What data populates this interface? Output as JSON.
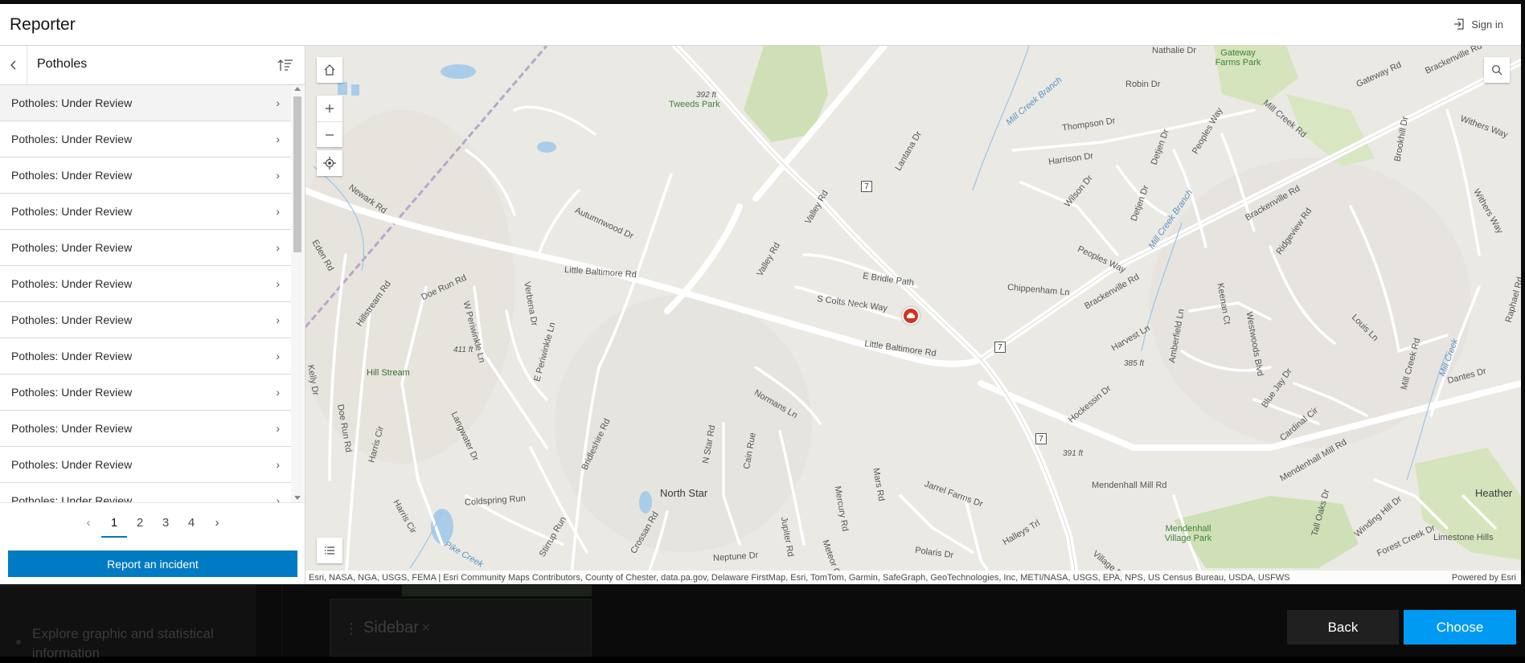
{
  "app": {
    "title": "Reporter",
    "sign_in_label": "Sign in"
  },
  "panel": {
    "title": "Potholes",
    "items": [
      {
        "label": "Potholes: Under Review"
      },
      {
        "label": "Potholes: Under Review"
      },
      {
        "label": "Potholes: Under Review"
      },
      {
        "label": "Potholes: Under Review"
      },
      {
        "label": "Potholes: Under Review"
      },
      {
        "label": "Potholes: Under Review"
      },
      {
        "label": "Potholes: Under Review"
      },
      {
        "label": "Potholes: Under Review"
      },
      {
        "label": "Potholes: Under Review"
      },
      {
        "label": "Potholes: Under Review"
      },
      {
        "label": "Potholes: Under Review"
      },
      {
        "label": "Potholes: Under Review"
      }
    ],
    "pages": [
      "1",
      "2",
      "3",
      "4"
    ],
    "current_page": "1",
    "report_button": "Report an incident"
  },
  "map": {
    "attribution": "Esri, NASA, NGA, USGS, FEMA | Esri Community Maps Contributors, County of Chester, data.pa.gov, Delaware FirstMap, Esri, TomTom, Garmin, SafeGraph, GeoTechnologies, Inc, METI/NASA, USGS, EPA, NPS, US Census Bureau, USDA, USFWS",
    "powered_by": "Powered by Esri",
    "places": {
      "north_star": "North Star",
      "heather": "Heather",
      "hill_stream": "Hill Stream",
      "limestone_hills": "Limestone Hills"
    },
    "parks": {
      "tweeds": "Tweeds Park",
      "gateway": "Gateway Farms Park",
      "mendenhall": "Mendenhall Village Park"
    },
    "water": {
      "mill_creek_branch_1": "Mill Creek Branch",
      "mill_creek_branch_2": "Mill Creek Branch",
      "mill_creek": "Mill Creek",
      "pike_creek": "Pike Creek"
    },
    "elevations": [
      "392 ft",
      "411 ft",
      "385 ft",
      "391 ft"
    ],
    "shields": [
      "7",
      "7",
      "7"
    ],
    "roads": {
      "nathalie": "Nathalie Dr",
      "robin": "Robin Dr",
      "gateway": "Gateway Rd",
      "brackenville_top": "Brackenville Rd",
      "mill_creek_rd_top": "Mill Creek Rd",
      "thompson": "Thompson Dr",
      "harrison": "Harrison Dr",
      "wilson": "Wilson Dr",
      "detjen1": "Detjen Dr",
      "detjen2": "Detjen Dr",
      "peoples_way1": "Peoples Way",
      "peoples_way2": "Peoples Way",
      "brookhill": "Brookhill Dr",
      "withers1": "Withers Way",
      "withers2": "Withers Way",
      "brackenville_mid": "Brackenville Rd",
      "brackenville_low": "Brackenville Rd",
      "ridgeview": "Ridgeview Rd",
      "raphael": "Raphael Rd",
      "lantana": "Lantana Dr",
      "valley_rd1": "Valley Rd",
      "valley_rd2": "Valley Rd",
      "newark": "Newark Rd",
      "autumnwood": "Autumnwood Dr",
      "eden": "Eden Rd",
      "little_baltimore1": "Little Baltimore Rd",
      "little_baltimore2": "Little Baltimore Rd",
      "e_bridle": "E Bridle Path",
      "s_colts": "S Colts Neck Way",
      "chippenham": "Chippenham Ln",
      "hillstream": "Hillstream Rd",
      "doe_run1": "Doe Run Rd",
      "doe_run2": "Doe Run Rd",
      "verbena": "Verbena Dr",
      "w_periwinkle": "W Periwinkle Ln",
      "e_periwinkle": "E Periwinkle Ln",
      "kelly": "Kelly Dr",
      "harvest": "Harvest Ln",
      "amberfield": "Amberfield Ln",
      "keenan": "Keenan Ct",
      "westwoods": "Westwoods Blvd",
      "louis": "Louis Ln",
      "mill_creek_rd_mid": "Mill Creek Rd",
      "dantes": "Dantes Dr",
      "normans": "Normans Ln",
      "hockessin": "Hockessin Dr",
      "blue_jay": "Blue Jay Dr",
      "cardinal": "Cardinal Cir",
      "mendenhall_mill1": "Mendenhall Mill Rd",
      "mendenhall_mill2": "Mendenhall Mill Rd",
      "harris_cir1": "Harris Cir",
      "harris_cir2": "Harris Cir",
      "langwater": "Langwater Dr",
      "bridleshire": "Bridleshire Rd",
      "n_star": "N Star Rd",
      "cain": "Cain Rue",
      "mercury": "Mercury Rd",
      "mars": "Mars Rd",
      "jarrel_farms": "Jarrel Farms Dr",
      "coldspring": "Coldspring Run",
      "tall_oaks": "Tall Oaks Dr",
      "winding_hill": "Winding Hill Dr",
      "forest_creek": "Forest Creek Dr",
      "halleys": "Halleys Trl",
      "polaris": "Polaris Dr",
      "neptune": "Neptune Dr",
      "jupiter": "Jupiter Rd",
      "meteor": "Meteor Ct",
      "crossan": "Crossan Rd",
      "stirrup": "Stirrup Run",
      "village": "Village Dr"
    }
  },
  "footer": {
    "back": "Back",
    "choose": "Choose"
  },
  "background": {
    "explore_text": "Explore graphic and statistical information",
    "sidebar_label": "Sidebar"
  },
  "colors": {
    "accent": "#007ac2",
    "choose": "#009af2",
    "marker": "#d0331e"
  }
}
